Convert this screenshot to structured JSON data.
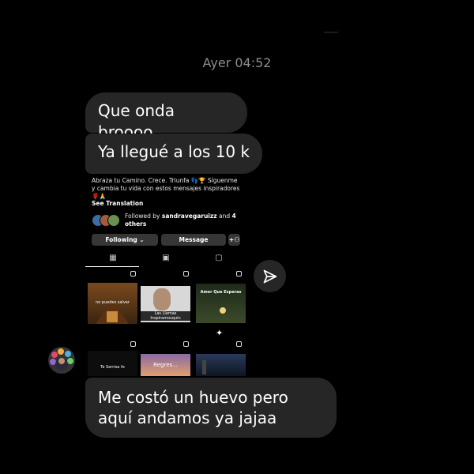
{
  "thread": {
    "timestamp": "Ayer 04:52"
  },
  "messages": [
    {
      "text": "Que onda broooo"
    },
    {
      "text": "Ya llegué a los 10 k"
    },
    {
      "text": "Me costó un huevo pero aquí andamos ya jajaa"
    }
  ],
  "shared_profile": {
    "bio": "Abraza tu Camino. Crece. Triunfa 👣🏆 Síguenme y cambia tu vida con estos mensajes inspiradores 🌹🙏",
    "see_translation": "See Translation",
    "followed_by_prefix": "Followed by ",
    "followed_by_user": "sandravegaruizz",
    "followed_by_suffix": " and ",
    "followed_by_count": "4 others",
    "following_label": "Following ⌄",
    "message_label": "Message",
    "posts": [
      {
        "caption": "no puedes salvar"
      },
      {
        "caption": "Las Llamas Inspiramosquin"
      },
      {
        "caption": "Amor Que Esperas"
      },
      {
        "caption": "Te Serrisa fe"
      },
      {
        "caption": "Regres..."
      },
      {
        "caption": ""
      }
    ]
  },
  "colors": {
    "bubble": "#262626",
    "timestamp": "#8e8e8e"
  }
}
